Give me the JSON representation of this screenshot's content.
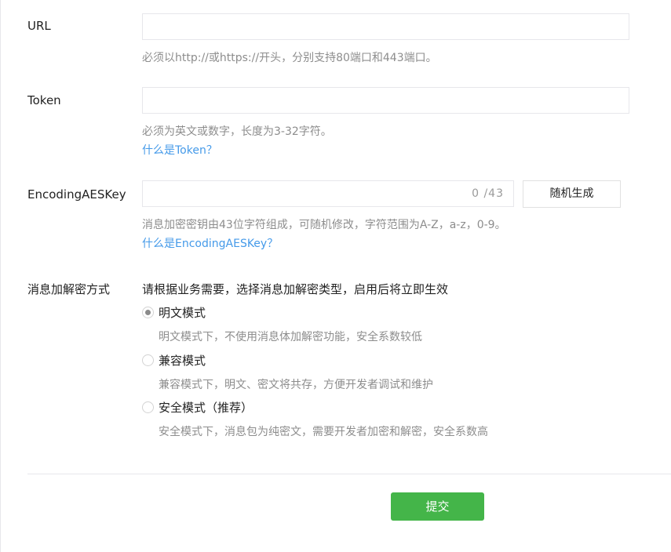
{
  "url": {
    "label": "URL",
    "value": "",
    "help": "必须以http://或https://开头，分别支持80端口和443端口。"
  },
  "token": {
    "label": "Token",
    "value": "",
    "help": "必须为英文或数字，长度为3-32字符。",
    "link": "什么是Token？"
  },
  "aes": {
    "label": "EncodingAESKey",
    "value": "",
    "counter": "0 /43",
    "generate_button": "随机生成",
    "help": "消息加密密钥由43位字符组成，可随机修改，字符范围为A-Z，a-z，0-9。",
    "link": "什么是EncodingAESKey？"
  },
  "encryption": {
    "label": "消息加解密方式",
    "intro": "请根据业务需要，选择消息加解密类型，启用后将立即生效",
    "options": [
      {
        "label": "明文模式",
        "desc": "明文模式下，不使用消息体加解密功能，安全系数较低",
        "checked": true
      },
      {
        "label": "兼容模式",
        "desc": "兼容模式下，明文、密文将共存，方便开发者调试和维护",
        "checked": false
      },
      {
        "label": "安全模式（推荐）",
        "desc": "安全模式下，消息包为纯密文，需要开发者加密和解密，安全系数高",
        "checked": false
      }
    ]
  },
  "submit_label": "提交",
  "colors": {
    "primary": "#44b549",
    "link": "#459ae9",
    "help": "#8d8d8d",
    "border": "#e7e7eb"
  }
}
